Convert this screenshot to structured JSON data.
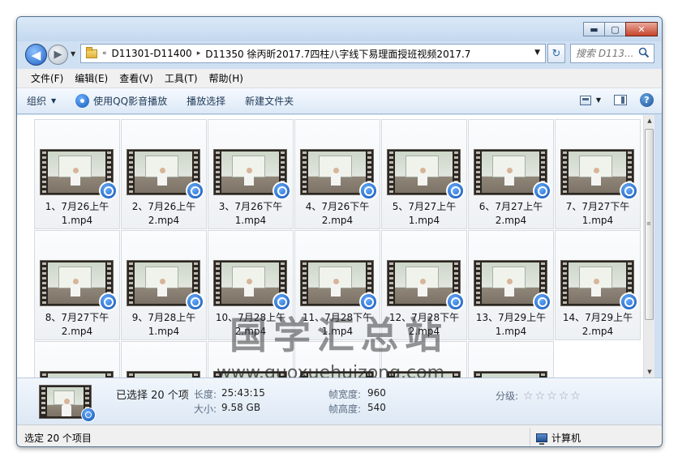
{
  "window": {
    "minimize_glyph": "▬",
    "maximize_glyph": "▢",
    "close_glyph": "✕"
  },
  "nav": {
    "back_glyph": "◀",
    "forward_glyph": "▶",
    "history_glyph": "▼",
    "refresh_glyph": "↻",
    "breadcrumbs": [
      "«",
      "D11301-D11400",
      "▸",
      "D11350 徐丙昕2017.7四柱八字线下易理面授班视频2017.7"
    ],
    "address_dropdown_glyph": "▼",
    "search_placeholder": "搜索 D113..."
  },
  "menu": [
    "文件(F)",
    "编辑(E)",
    "查看(V)",
    "工具(T)",
    "帮助(H)"
  ],
  "toolbar": {
    "organize": "组织",
    "organize_caret": "▼",
    "play_with_qq": "使用QQ影音播放",
    "play_selection": "播放选择",
    "new_folder": "新建文件夹",
    "view_caret": "▼",
    "help_glyph": "?"
  },
  "files": [
    {
      "line1": "1、7月26上午",
      "line2": "1.mp4"
    },
    {
      "line1": "2、7月26上午",
      "line2": "2.mp4"
    },
    {
      "line1": "3、7月26下午",
      "line2": "1.mp4"
    },
    {
      "line1": "4、7月26下午",
      "line2": "2.mp4"
    },
    {
      "line1": "5、7月27上午",
      "line2": "1.mp4"
    },
    {
      "line1": "6、7月27上午",
      "line2": "2.mp4"
    },
    {
      "line1": "7、7月27下午",
      "line2": "1.mp4"
    },
    {
      "line1": "8、7月27下午",
      "line2": "2.mp4"
    },
    {
      "line1": "9、7月28上午",
      "line2": "1.mp4"
    },
    {
      "line1": "10、7月28上午",
      "line2": "2.mp4"
    },
    {
      "line1": "11、7月28下午",
      "line2": "1.mp4"
    },
    {
      "line1": "12、7月28下午",
      "line2": "2.mp4"
    },
    {
      "line1": "13、7月29上午",
      "line2": "1.mp4"
    },
    {
      "line1": "14、7月29上午",
      "line2": "2.mp4"
    },
    {
      "line1": "",
      "line2": ""
    },
    {
      "line1": "",
      "line2": ""
    },
    {
      "line1": "",
      "line2": ""
    },
    {
      "line1": "",
      "line2": ""
    },
    {
      "line1": "",
      "line2": ""
    },
    {
      "line1": "",
      "line2": ""
    }
  ],
  "watermark": {
    "text": "国学汇总站",
    "url": "www.guoxuehuizong.com"
  },
  "scrollbar": {
    "up_glyph": "▲",
    "down_glyph": "▼",
    "grip_glyph": "≡"
  },
  "details": {
    "selected_text": "已选择 20 个项",
    "length_label": "长度:",
    "length_value": "25:43:15",
    "size_label": "大小:",
    "size_value": "9.58 GB",
    "frame_width_label": "帧宽度:",
    "frame_width_value": "960",
    "frame_height_label": "帧高度:",
    "frame_height_value": "540",
    "rating_label": "分级:",
    "rating_stars": 0
  },
  "status": {
    "left": "选定 20 个项目",
    "right": "计算机"
  }
}
